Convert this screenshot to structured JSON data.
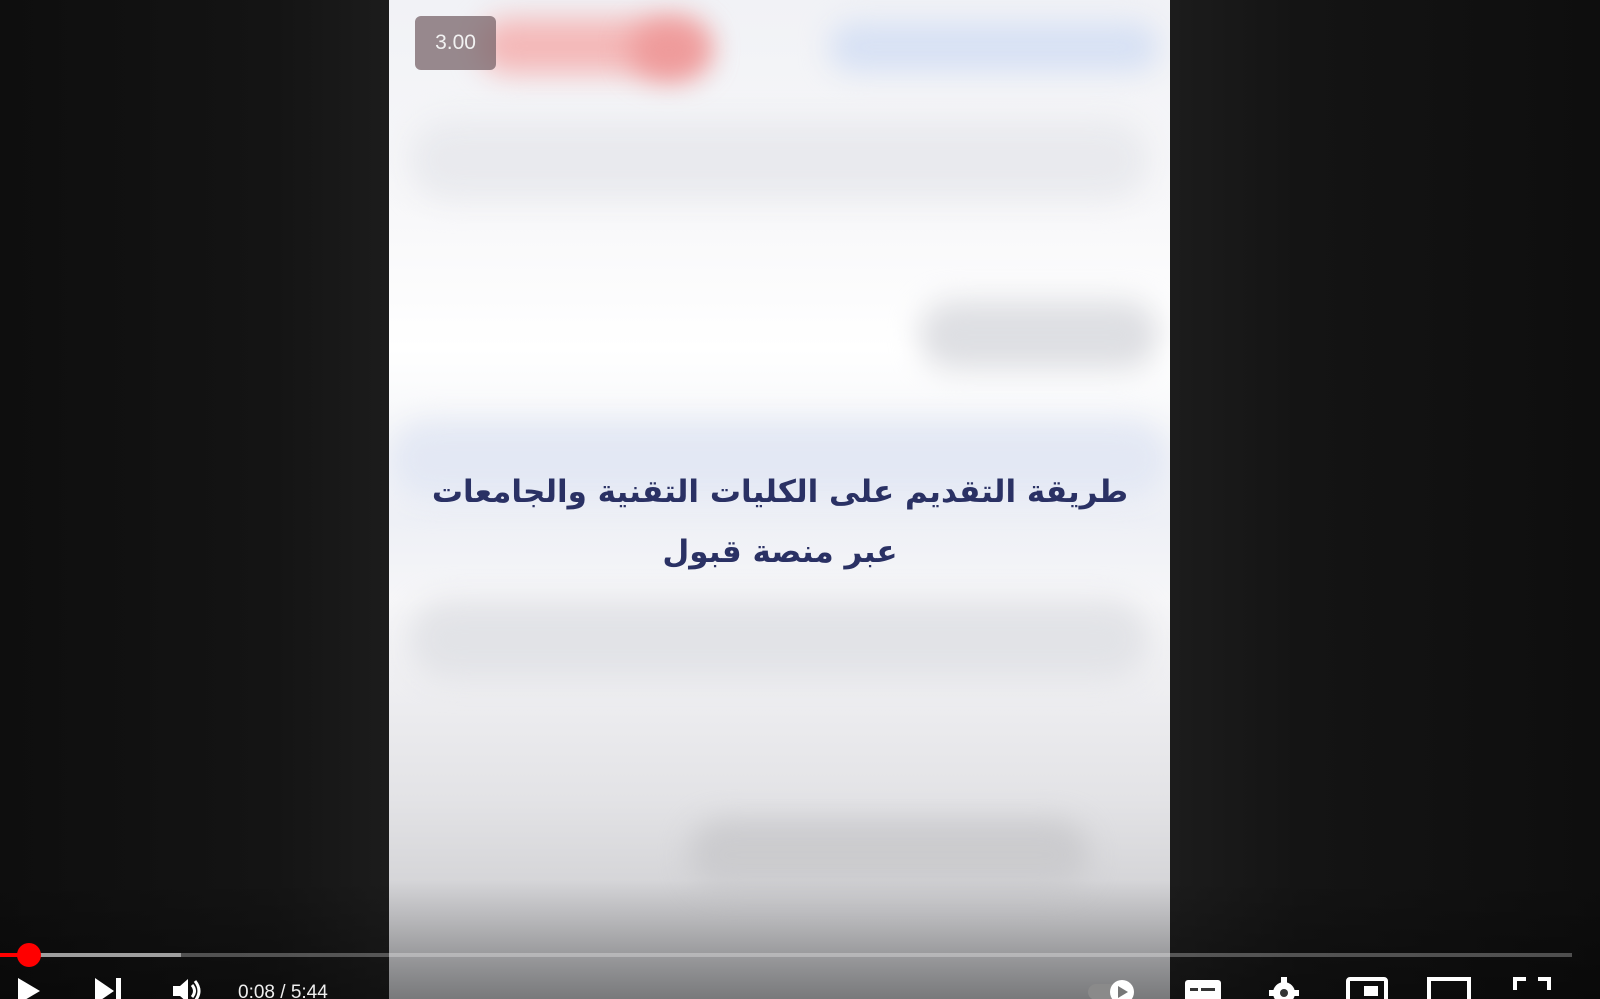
{
  "overlay": {
    "speed_label": "3.00"
  },
  "video": {
    "title_line1": "طريقة التقديم على الكليات التقنية والجامعات",
    "title_line2": "عبر منصة قبول"
  },
  "controls": {
    "time_current": "0:08",
    "time_separator": " / ",
    "time_total": "5:44",
    "played_fraction": 0.023,
    "buffered_fraction": 0.115,
    "accent_color": "#ff0000",
    "icons": [
      "play-icon",
      "next-icon",
      "volume-icon",
      "autoplay-toggle",
      "subtitles-icon",
      "settings-icon",
      "miniplayer-icon",
      "theater-icon",
      "fullscreen-icon"
    ]
  }
}
